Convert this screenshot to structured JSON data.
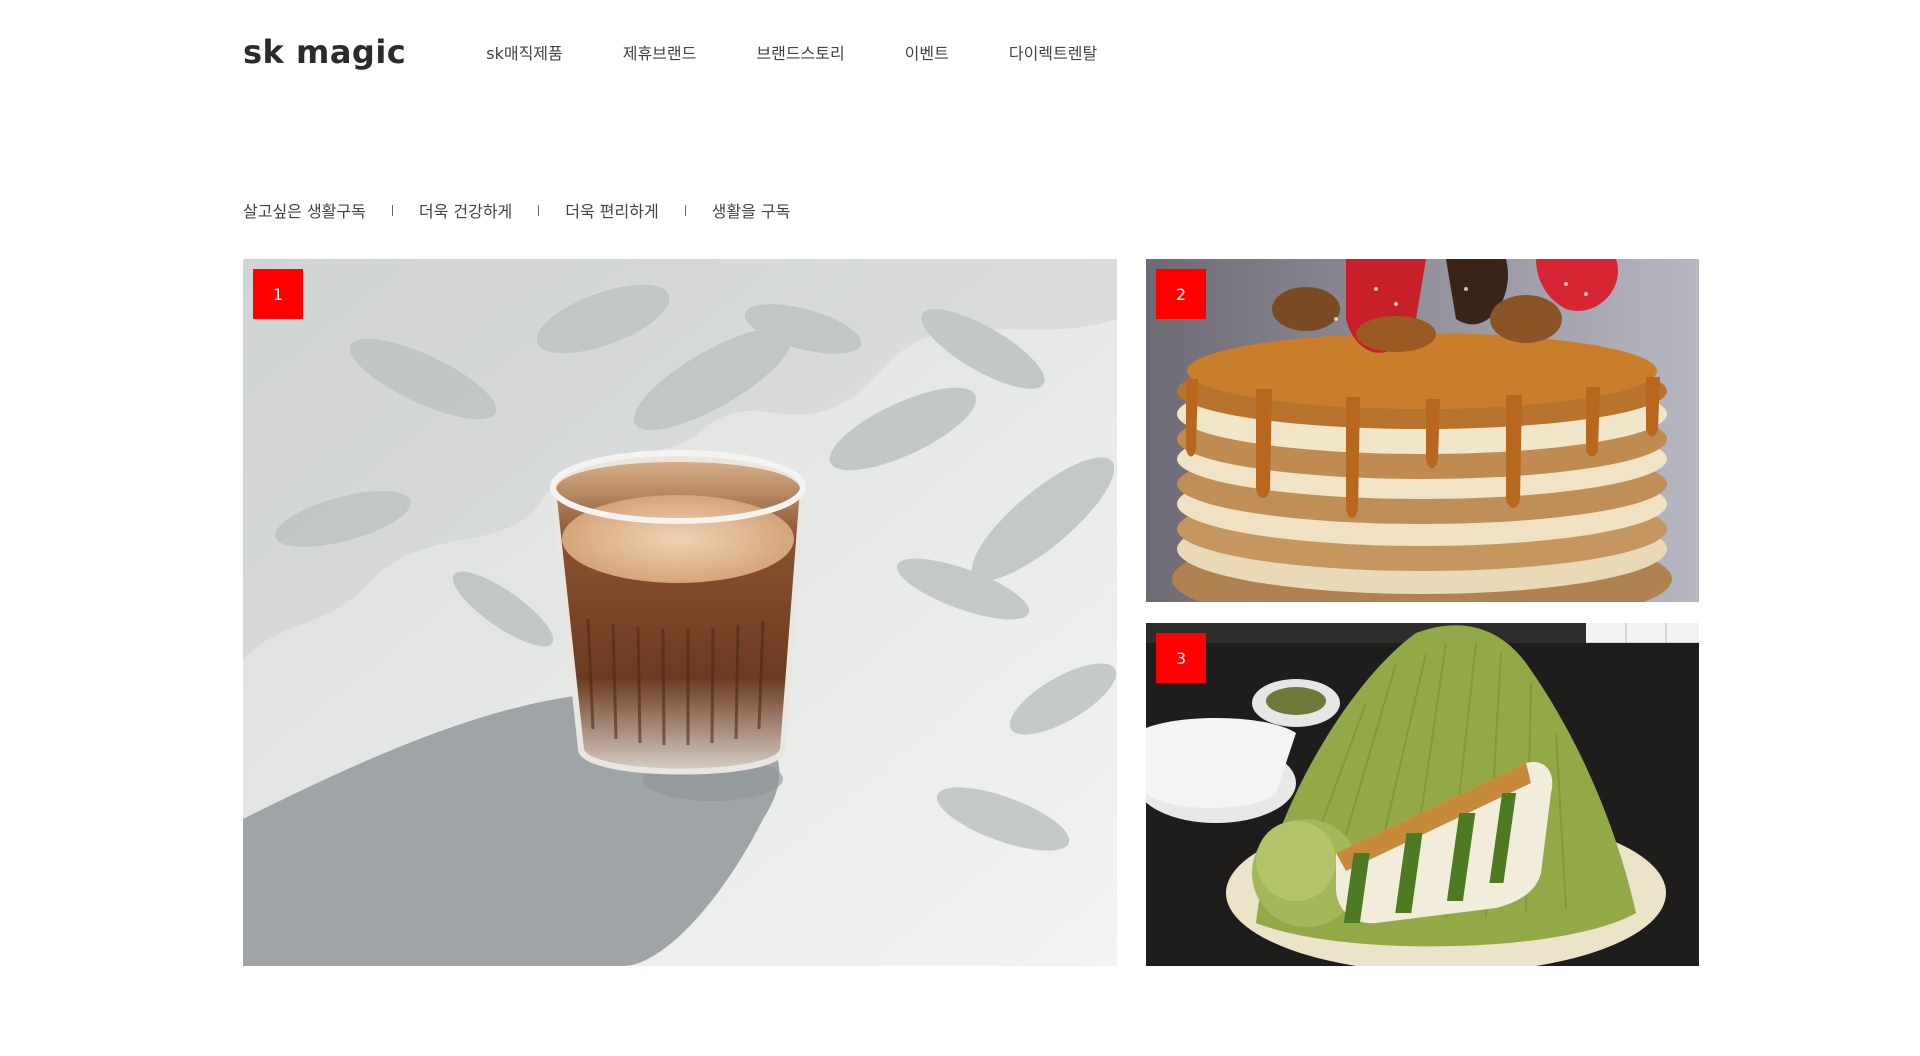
{
  "header": {
    "logo": "sk magic",
    "nav": [
      {
        "label": "sk매직제품"
      },
      {
        "label": "제휴브랜드"
      },
      {
        "label": "브랜드스토리"
      },
      {
        "label": "이벤트"
      },
      {
        "label": "다이렉트렌탈"
      }
    ]
  },
  "sub_menu": [
    {
      "label": "살고싶은 생활구독"
    },
    {
      "label": "더욱 건강하게"
    },
    {
      "label": "더욱 편리하게"
    },
    {
      "label": "생활을 구독"
    }
  ],
  "gallery": {
    "items": [
      {
        "number": "1",
        "image": "coffee-glass-photo"
      },
      {
        "number": "2",
        "image": "pancake-stack-photo"
      },
      {
        "number": "3",
        "image": "matcha-bingsu-photo"
      }
    ]
  },
  "colors": {
    "badge": "#ff0000",
    "text": "#444444",
    "logo": "#2b2b2b"
  }
}
